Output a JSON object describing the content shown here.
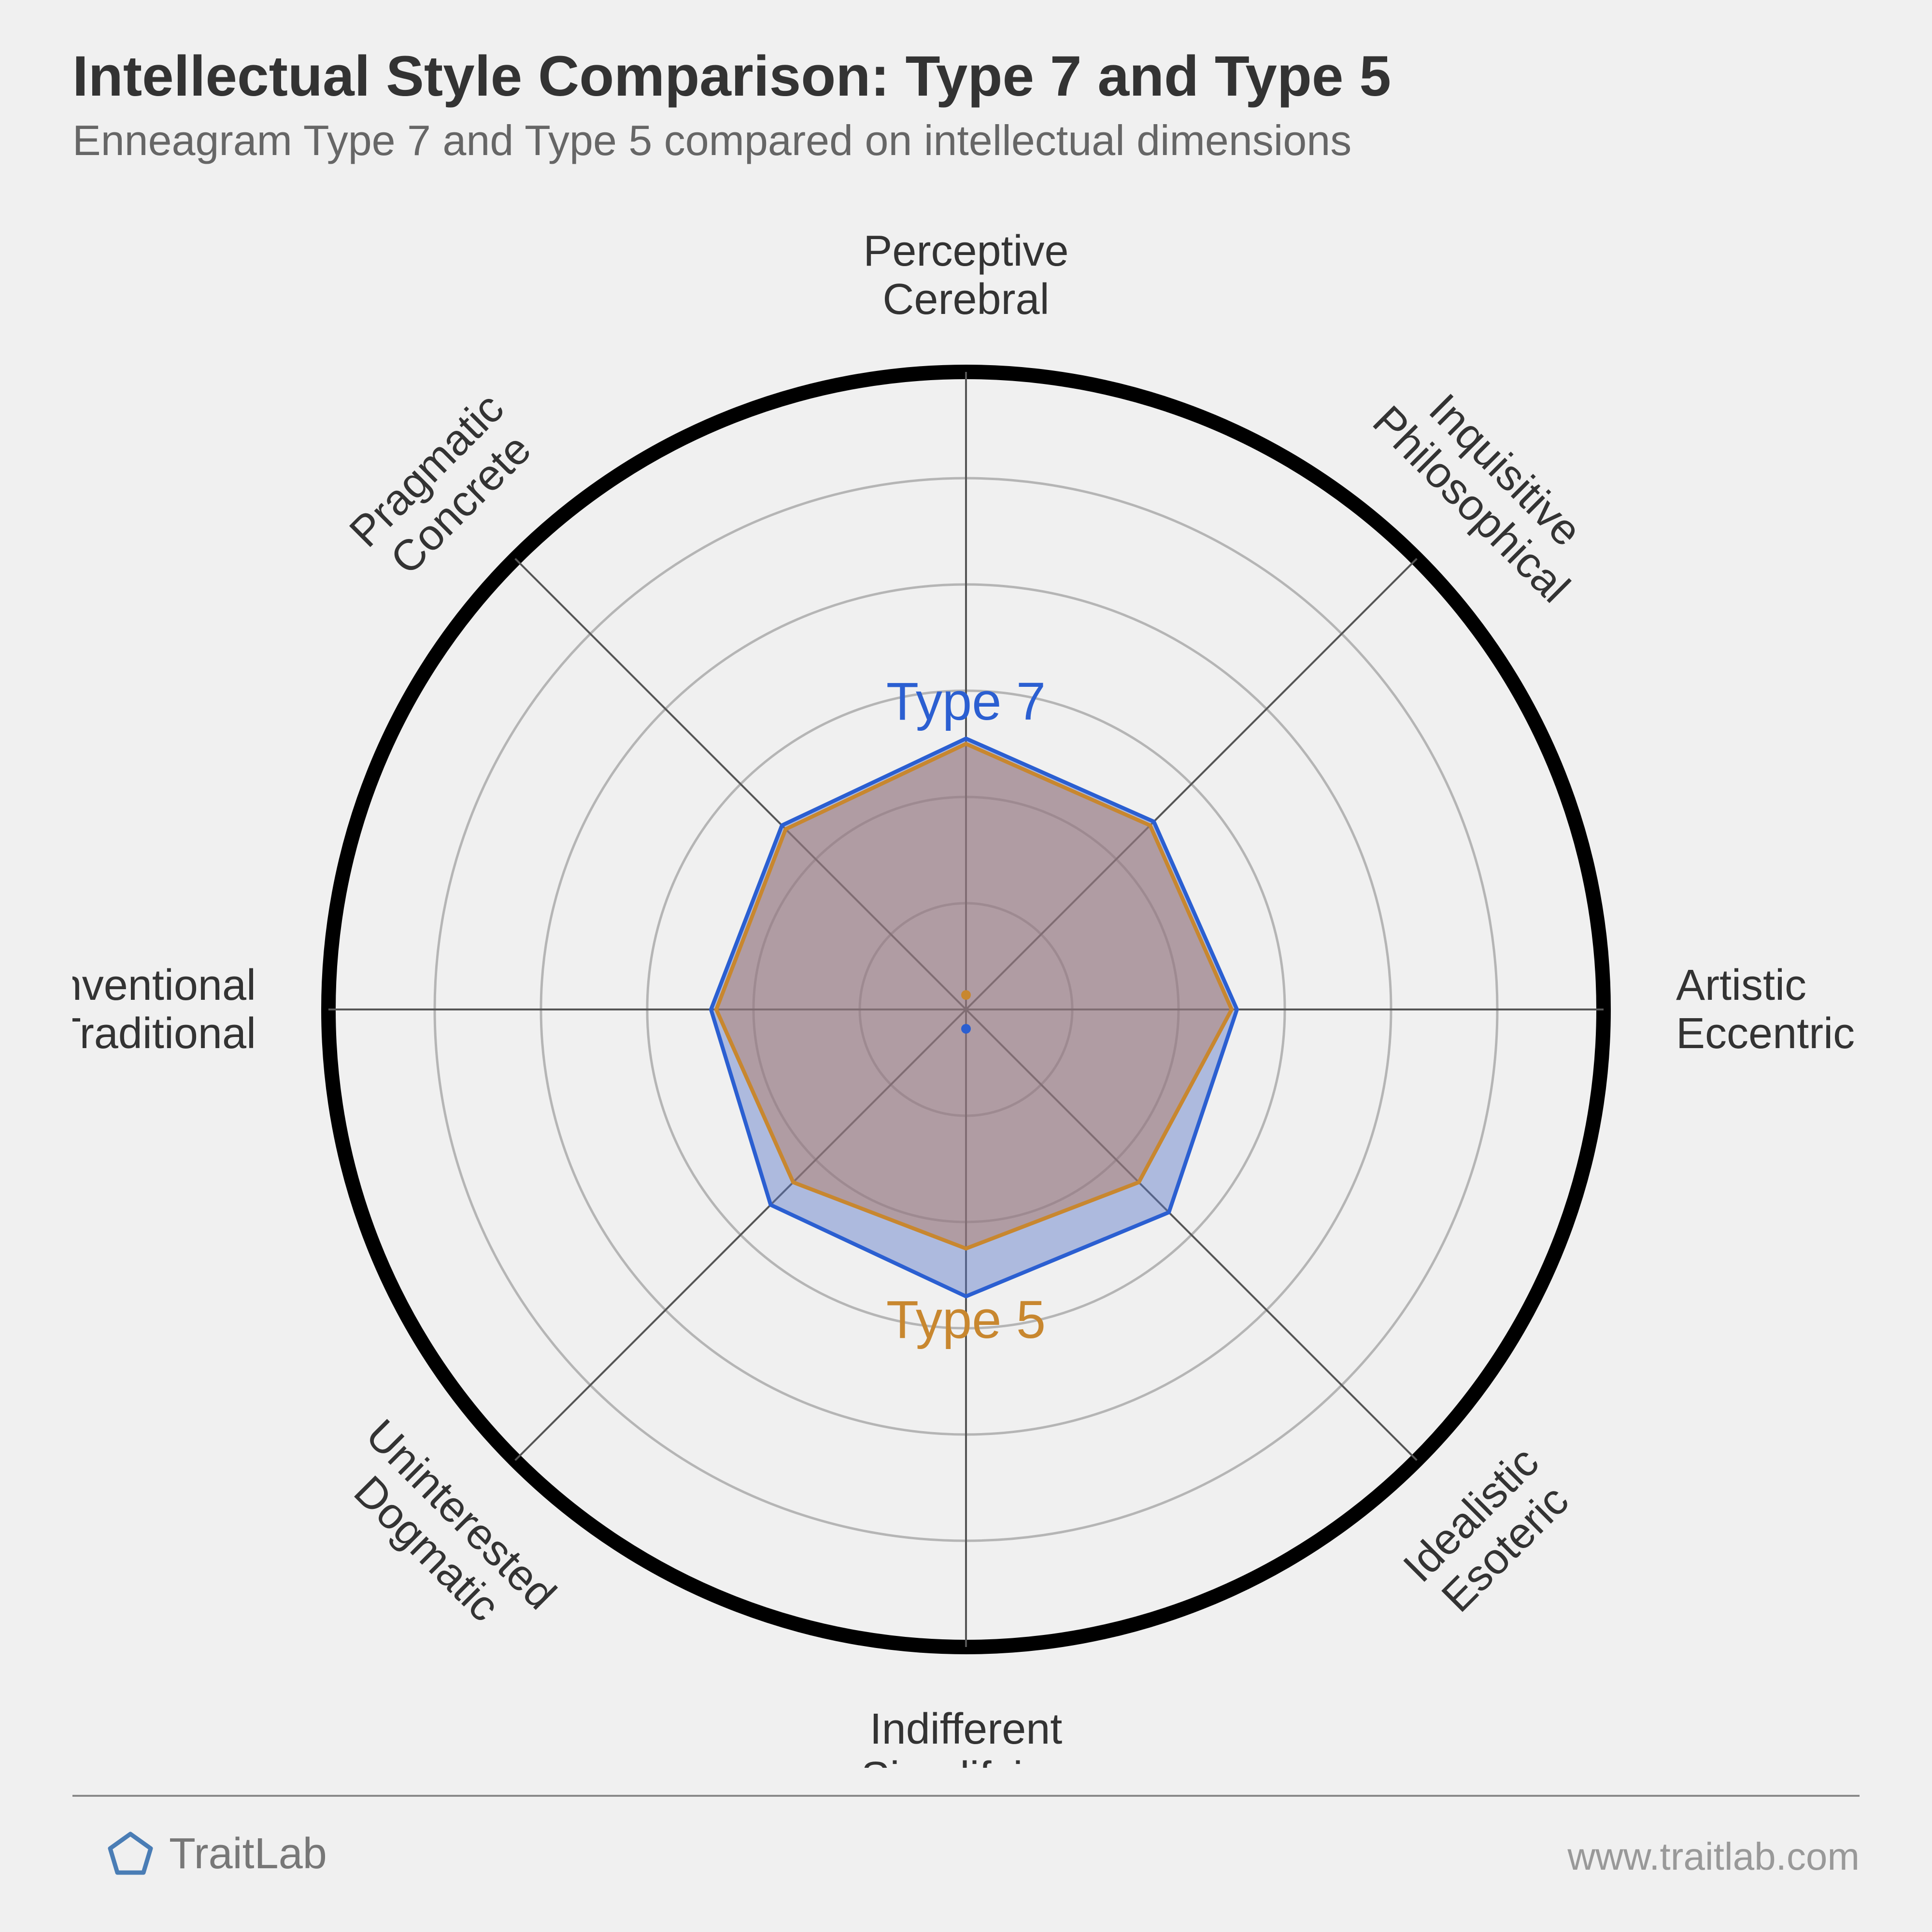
{
  "title": "Intellectual Style Comparison: Type 7 and Type 5",
  "subtitle": "Enneagram Type 7 and Type 5 compared on intellectual dimensions",
  "footer": {
    "brand": "TraitLab",
    "url": "www.traitlab.com"
  },
  "chart_data": {
    "type": "radar",
    "axes": [
      {
        "labelTop": "Perceptive",
        "labelBottom": "Cerebral",
        "angle": 0
      },
      {
        "labelTop": "Inquisitive",
        "labelBottom": "Philosophical",
        "angle": 45
      },
      {
        "labelTop": "Artistic",
        "labelBottom": "Eccentric",
        "angle": 90
      },
      {
        "labelTop": "Idealistic",
        "labelBottom": "Esoteric",
        "angle": 135
      },
      {
        "labelTop": "Indifferent",
        "labelBottom": "Simplifying",
        "angle": 180
      },
      {
        "labelTop": "Uninterested",
        "labelBottom": "Dogmatic",
        "angle": 225
      },
      {
        "labelTop": "Conventional",
        "labelBottom": "Traditional",
        "angle": 270
      },
      {
        "labelTop": "Pragmatic",
        "labelBottom": "Concrete",
        "angle": 315
      }
    ],
    "rings": 6,
    "max": 6,
    "series": [
      {
        "name": "Type 7",
        "color": "#2b5fd1",
        "fill": "rgba(90,120,200,0.45)",
        "values": [
          2.55,
          2.5,
          2.55,
          2.7,
          2.7,
          2.6,
          2.4,
          2.45
        ]
      },
      {
        "name": "Type 5",
        "color": "#c8872f",
        "fill": "rgba(180,120,90,0.45)",
        "values": [
          2.5,
          2.45,
          2.5,
          2.3,
          2.25,
          2.3,
          2.35,
          2.4
        ]
      }
    ],
    "seriesLabels": {
      "type7": "Type 7",
      "type5": "Type 5"
    }
  }
}
